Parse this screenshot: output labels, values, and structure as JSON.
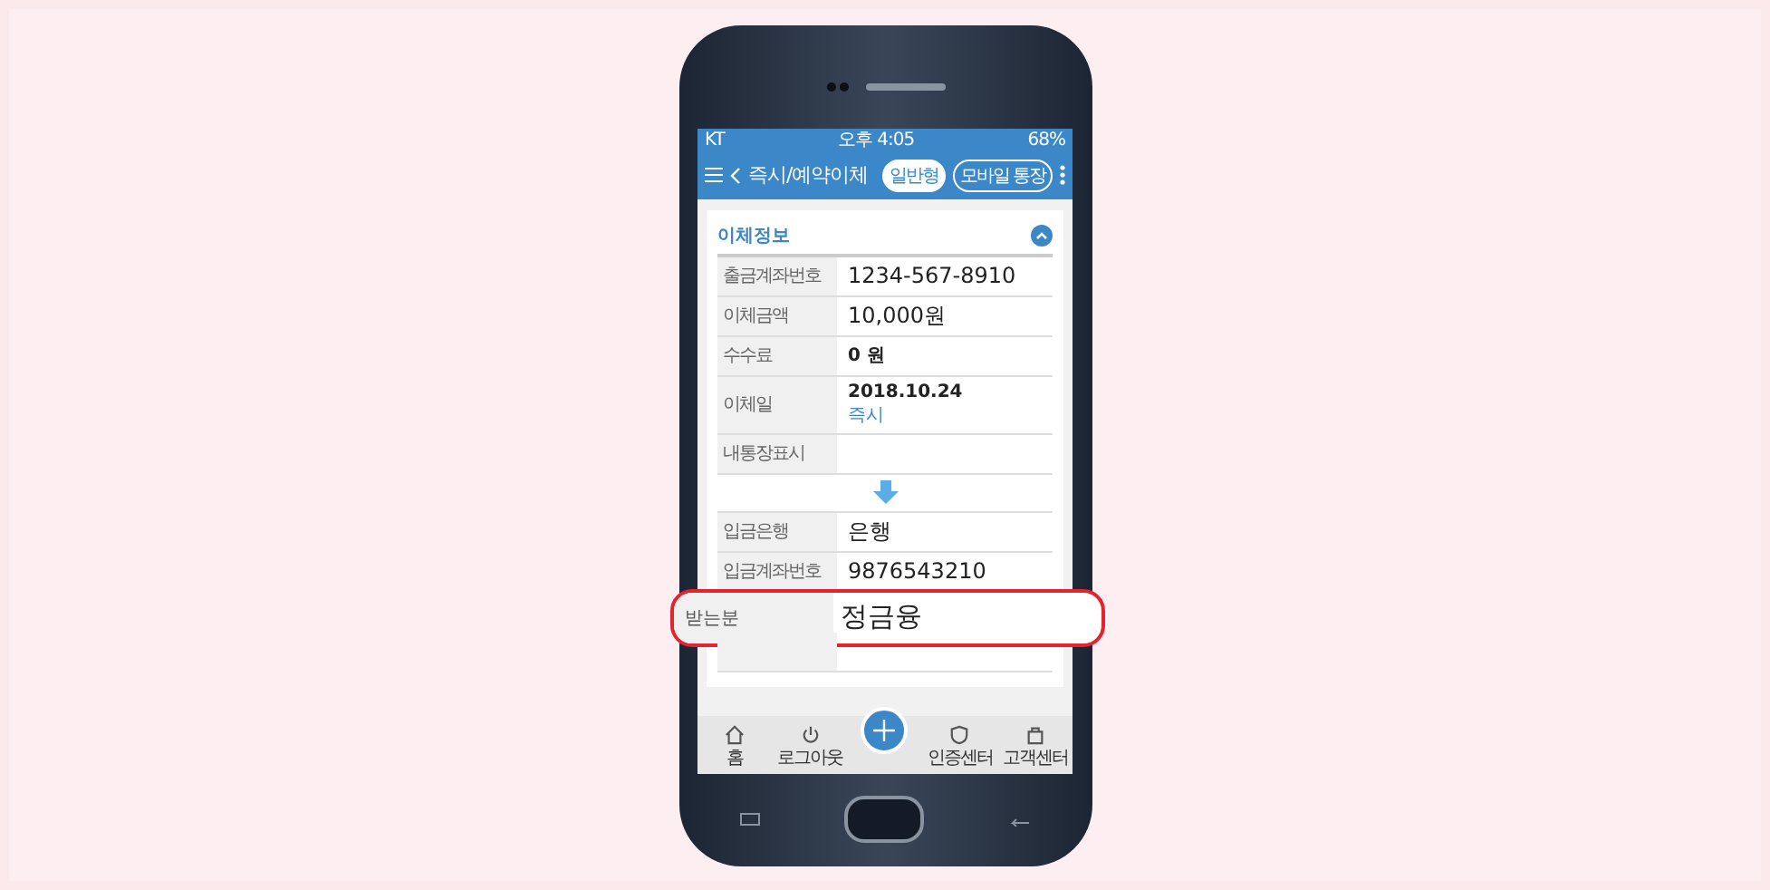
{
  "status_bar": {
    "carrier": "KT",
    "time": "오후 4:05",
    "battery": "68%"
  },
  "header": {
    "title": "즉시/예약이체",
    "buttons": [
      {
        "label": "일반형",
        "selected": true
      },
      {
        "label": "모바일 통장",
        "selected": false
      }
    ]
  },
  "card": {
    "title": "이체정보",
    "expanded": true,
    "from_rows": [
      {
        "kind": "field",
        "label": "출금계좌번호",
        "value": "1234-567-8910"
      },
      {
        "kind": "field",
        "label": "이체금액",
        "value": "10,000원"
      },
      {
        "kind": "bold",
        "label": "수수료",
        "value": "0 원"
      },
      {
        "kind": "date",
        "label": "이체일",
        "value": "2018.10.24",
        "note": "즉시"
      },
      {
        "kind": "field",
        "label": "내통장표시"
      }
    ],
    "to_rows": [
      {
        "kind": "field",
        "label": "입금은행",
        "value": "은행"
      },
      {
        "kind": "field",
        "label": "입금계좌번호",
        "value": "9876543210"
      },
      {
        "kind": "magnified",
        "label": "받는분",
        "value": "정금융"
      }
    ]
  },
  "bottom_nav": [
    {
      "kind": "home",
      "label": "홈"
    },
    {
      "kind": "power",
      "label": "로그아웃"
    },
    {
      "kind": "plus"
    },
    {
      "kind": "shield",
      "label": "인증센터"
    },
    {
      "kind": "bag",
      "label": "고객센터"
    }
  ]
}
